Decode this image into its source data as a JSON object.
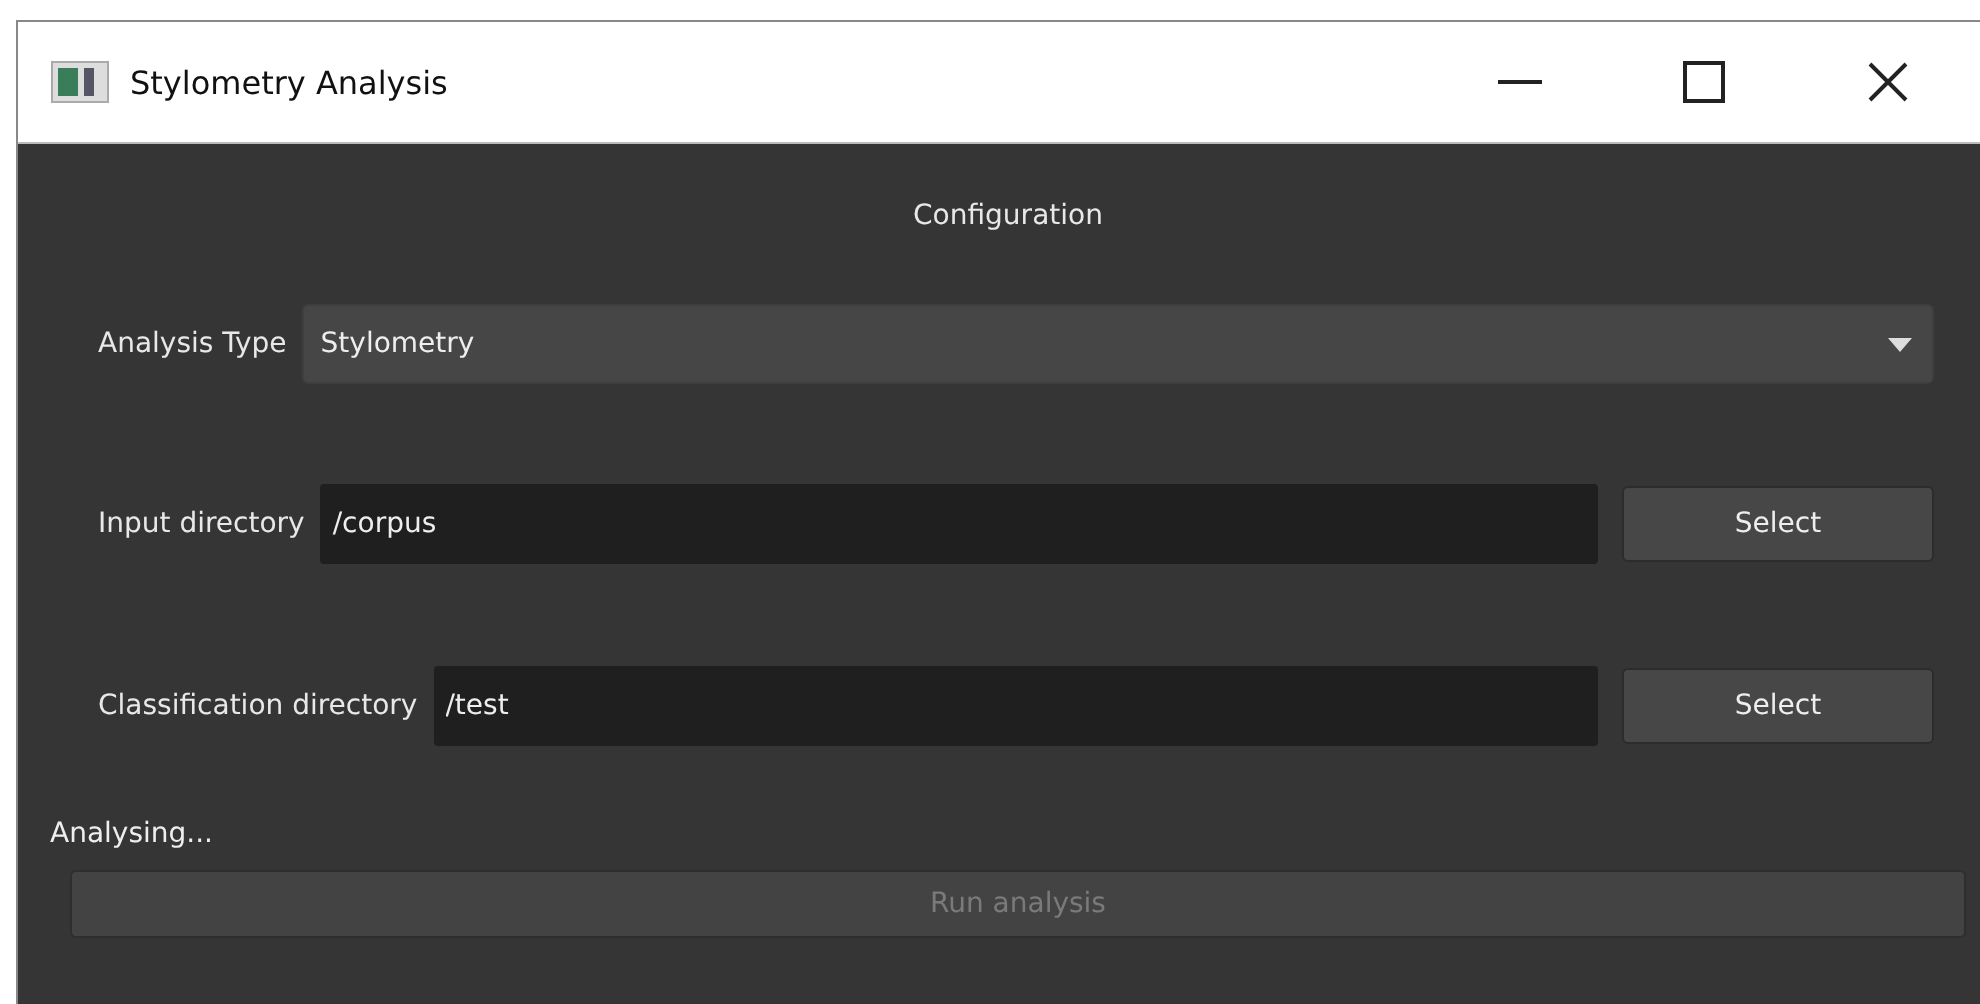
{
  "window": {
    "title": "Stylometry Analysis"
  },
  "section_title": "Configuration",
  "analysis_type": {
    "label": "Analysis Type",
    "value": "Stylometry"
  },
  "directories": [
    {
      "label": "Input directory",
      "value": "/corpus",
      "button": "Select"
    },
    {
      "label": "Classification directory",
      "value": "/test",
      "button": "Select"
    }
  ],
  "status": "Analysing...",
  "run_button": {
    "label": "Run analysis",
    "disabled": true
  }
}
